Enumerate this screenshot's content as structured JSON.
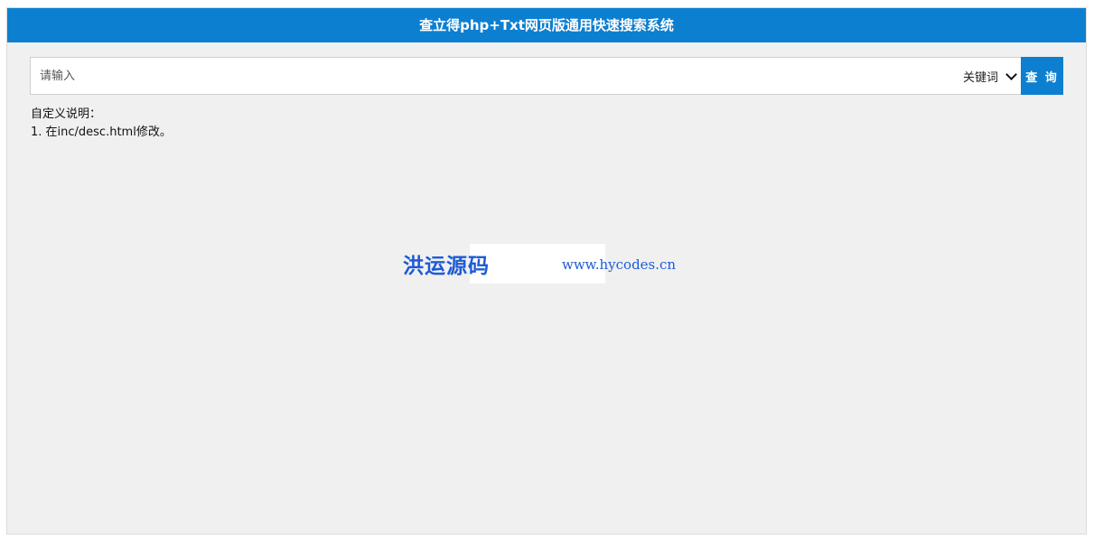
{
  "header": {
    "title": "查立得php+Txt网页版通用快速搜索系统"
  },
  "search": {
    "placeholder": "请输入",
    "value": "",
    "field_selected": "关键词",
    "field_icon": "chevron-down-icon",
    "submit_label": "查 询"
  },
  "description": {
    "heading": "自定义说明：",
    "lines": [
      "1. 在inc/desc.html修改。"
    ]
  },
  "watermark": {
    "brand": "洪运源码",
    "url": "www.hycodes.cn"
  },
  "colors": {
    "accent": "#0d7fd0",
    "background": "#f0f0f0",
    "watermark": "#1d5bd6"
  }
}
